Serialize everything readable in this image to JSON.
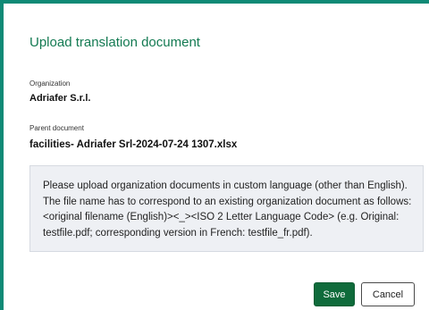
{
  "dialog": {
    "title": "Upload translation document",
    "organization_label": "Organization",
    "organization_value": "Adriafer S.r.l.",
    "parent_label": "Parent document",
    "parent_value": "facilities- Adriafer Srl-2024-07-24 1307.xlsx",
    "info_text": "Please upload organization documents in custom language (other than English). The file name has to correspond to an existing organization document as follows: <original filename (English)><_><ISO 2 Letter Language Code> (e.g. Original: testfile.pdf; corresponding version in French: testfile_fr.pdf).",
    "save_label": "Save",
    "cancel_label": "Cancel"
  },
  "colors": {
    "accent_border": "#0f8a76",
    "title": "#137a52",
    "save_button": "#0f6b3b",
    "info_background": "#eef0f4"
  }
}
